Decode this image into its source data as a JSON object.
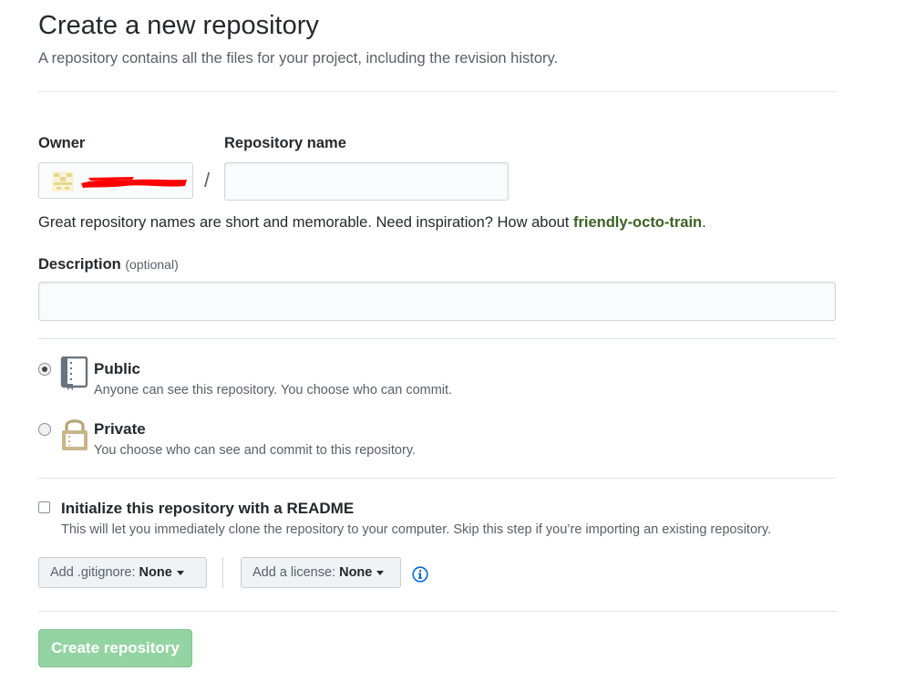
{
  "header": {
    "title": "Create a new repository",
    "subtitle": "A repository contains all the files for your project, including the revision history."
  },
  "owner": {
    "label": "Owner",
    "avatar_icon": "identicon-avatar",
    "redacted": true
  },
  "repo_name": {
    "label": "Repository name",
    "value": "",
    "separator": "/"
  },
  "hint": {
    "text": "Great repository names are short and memorable. Need inspiration? How about ",
    "suggestion": "friendly-octo-train",
    "suffix": "."
  },
  "description": {
    "label": "Description",
    "optional": "(optional)",
    "value": ""
  },
  "visibility": {
    "public": {
      "title": "Public",
      "desc": "Anyone can see this repository. You choose who can commit.",
      "icon": "repo-book-icon",
      "selected": true
    },
    "private": {
      "title": "Private",
      "desc": "You choose who can see and commit to this repository.",
      "icon": "lock-icon",
      "selected": false
    }
  },
  "readme": {
    "label": "Initialize this repository with a README",
    "desc": "This will let you immediately clone the repository to your computer. Skip this step if you’re importing an existing repository.",
    "checked": false
  },
  "gitignore": {
    "prefix": "Add .gitignore:",
    "value": "None"
  },
  "license": {
    "prefix": "Add a license:",
    "value": "None"
  },
  "info_icon": "info-icon",
  "submit": {
    "label": "Create repository"
  },
  "colors": {
    "suggestion": "#3a6324",
    "submit_bg": "#94d3a2",
    "info": "#0366d6"
  }
}
